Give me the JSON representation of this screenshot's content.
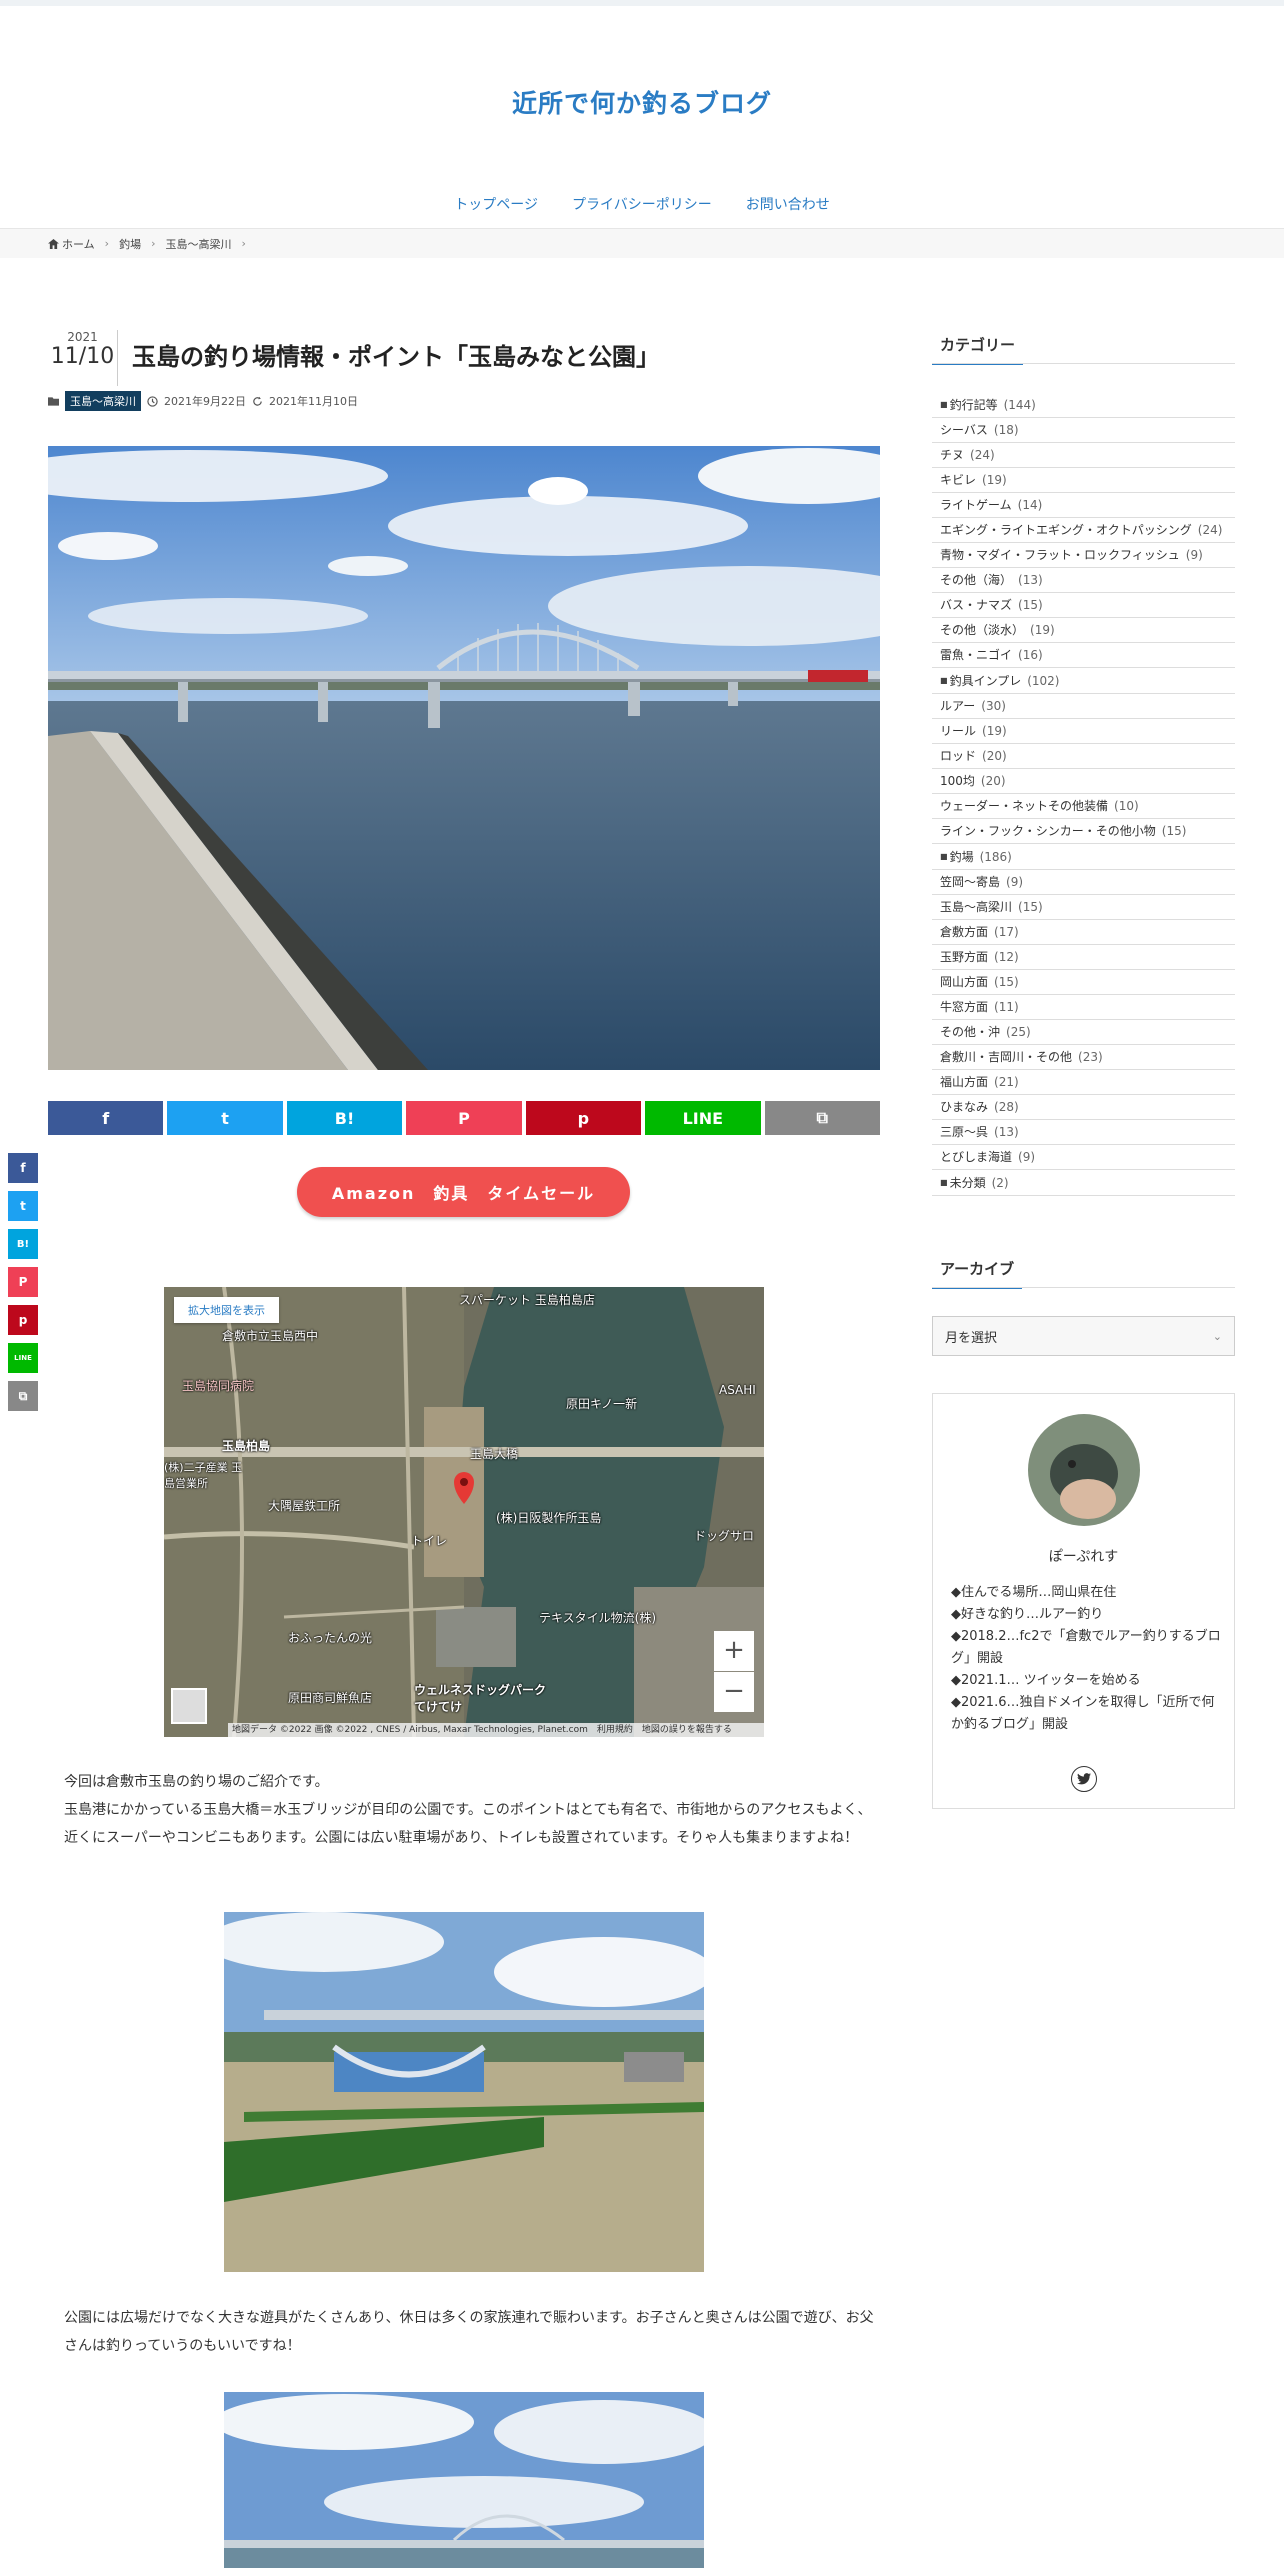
{
  "site": {
    "title": "近所で何か釣るブログ"
  },
  "nav": {
    "items": [
      "トップページ",
      "プライバシーポリシー",
      "お問い合わせ"
    ]
  },
  "breadcrumb": {
    "home": "ホーム",
    "level1": "釣場",
    "level2": "玉島～高梁川"
  },
  "post": {
    "year": "2021",
    "month_day": "11/10",
    "title": "玉島の釣り場情報・ポイント「玉島みなと公園」",
    "category": "玉島～高梁川",
    "published": "2021年9月22日",
    "updated": "2021年11月10日"
  },
  "share": {
    "buttons": [
      {
        "name": "facebook",
        "label": "f",
        "color": "#3b5998"
      },
      {
        "name": "twitter",
        "label": "t",
        "color": "#1da1f2"
      },
      {
        "name": "hatena",
        "label": "B!",
        "color": "#00a4de"
      },
      {
        "name": "pocket",
        "label": "P",
        "color": "#ef4056"
      },
      {
        "name": "pinterest",
        "label": "p",
        "color": "#bd081c"
      },
      {
        "name": "line",
        "label": "LINE",
        "color": "#00b900"
      },
      {
        "name": "copy",
        "label": "⧉",
        "color": "#888888"
      }
    ]
  },
  "amazon_button": {
    "label": "Amazon　釣具　タイムセール"
  },
  "map": {
    "large_map_link": "拡大地図を表示",
    "labels": [
      "スパーケット 玉島柏島店",
      "倉敷市立玉島西中",
      "玉島協同病院",
      "玉島柏島",
      "(株)二子産業 玉島営業所",
      "大隅屋鉄工所",
      "トイレ",
      "玉島大橋",
      "原田キノ一新",
      "ASAHI",
      "(株)日阪製作所玉島",
      "ドッグサロ",
      "テキスタイル物流(株)",
      "おふったんの光",
      "原田商司鮮魚店",
      "ウェルネスドッグパーク てけてけ"
    ],
    "zoom_in": "+",
    "zoom_out": "−",
    "footer": "地図データ ©2022 画像 ©2022 , CNES / Airbus, Maxar Technologies, Planet.com　利用規約　地図の誤りを報告する"
  },
  "content": {
    "para1": "今回は倉敷市玉島の釣り場のご紹介です。\n玉島港にかかっている玉島大橋＝水玉ブリッジが目印の公園です。このポイントはとても有名で、市街地からのアクセスもよく、近くにスーパーやコンビニもあります。公園には広い駐車場があり、トイレも設置されています。そりゃ人も集まりますよね！",
    "para2": "公園には広場だけでなく大きな遊具がたくさんあり、休日は多くの家族連れで賑わいます。お子さんと奥さんは公園で遊び、お父さんは釣りっていうのもいいですね！"
  },
  "sidebar": {
    "categories_title": "カテゴリー",
    "categories": [
      {
        "label": "釣行記等",
        "count": "(144)",
        "parent": true
      },
      {
        "label": "シーバス",
        "count": "(18)"
      },
      {
        "label": "チヌ",
        "count": "(24)"
      },
      {
        "label": "キビレ",
        "count": "(19)"
      },
      {
        "label": "ライトゲーム",
        "count": "(14)"
      },
      {
        "label": "エギング・ライトエギング・オクトパッシング",
        "count": "(24)"
      },
      {
        "label": "青物・マダイ・フラット・ロックフィッシュ",
        "count": "(9)"
      },
      {
        "label": "その他（海）",
        "count": "(13)"
      },
      {
        "label": "バス・ナマズ",
        "count": "(15)"
      },
      {
        "label": "その他（淡水）",
        "count": "(19)"
      },
      {
        "label": "雷魚・ニゴイ",
        "count": "(16)"
      },
      {
        "label": "釣具インプレ",
        "count": "(102)",
        "parent": true
      },
      {
        "label": "ルアー",
        "count": "(30)"
      },
      {
        "label": "リール",
        "count": "(19)"
      },
      {
        "label": "ロッド",
        "count": "(20)"
      },
      {
        "label": "100均",
        "count": "(20)"
      },
      {
        "label": "ウェーダー・ネットその他装備",
        "count": "(10)"
      },
      {
        "label": "ライン・フック・シンカー・その他小物",
        "count": "(15)"
      },
      {
        "label": "釣場",
        "count": "(186)",
        "parent": true
      },
      {
        "label": "笠岡～寄島",
        "count": "(9)"
      },
      {
        "label": "玉島～高梁川",
        "count": "(15)"
      },
      {
        "label": "倉敷方面",
        "count": "(17)"
      },
      {
        "label": "玉野方面",
        "count": "(12)"
      },
      {
        "label": "岡山方面",
        "count": "(15)"
      },
      {
        "label": "牛窓方面",
        "count": "(11)"
      },
      {
        "label": "その他・沖",
        "count": "(25)"
      },
      {
        "label": "倉敷川・吉岡川・その他",
        "count": "(23)"
      },
      {
        "label": "福山方面",
        "count": "(21)"
      },
      {
        "label": "ひまなみ",
        "count": "(28)"
      },
      {
        "label": "三原～呉",
        "count": "(13)"
      },
      {
        "label": "とびしま海道",
        "count": "(9)"
      },
      {
        "label": "未分類",
        "count": "(2)",
        "parent": true
      }
    ],
    "archive_title": "アーカイブ",
    "archive_select": "月を選択",
    "profile": {
      "name": "ぽーぷれす",
      "lines": [
        "◆住んでる場所…岡山県在住",
        "◆好きな釣り…ルアー釣り",
        "◆2018.2…fc2で「倉敷でルアー釣りするブログ」開設",
        "◆2021.1… ツイッターを始める",
        "◆2021.6…独自ドメインを取得し「近所で何か釣るブログ」開設"
      ]
    }
  }
}
